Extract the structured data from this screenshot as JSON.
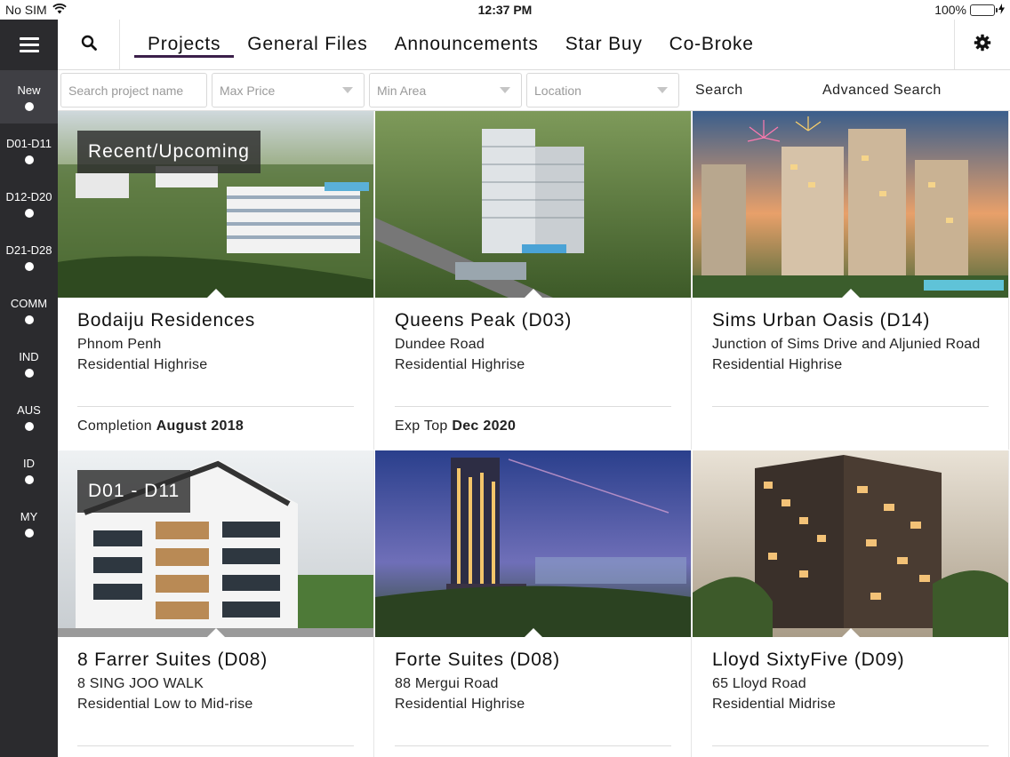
{
  "status_bar": {
    "carrier": "No SIM",
    "time": "12:37 PM",
    "battery": "100%",
    "battery_level": 1.0
  },
  "sidebar": {
    "items": [
      {
        "label": "New",
        "active": true
      },
      {
        "label": "D01-D11",
        "active": false
      },
      {
        "label": "D12-D20",
        "active": false
      },
      {
        "label": "D21-D28",
        "active": false
      },
      {
        "label": "COMM",
        "active": false
      },
      {
        "label": "IND",
        "active": false
      },
      {
        "label": "AUS",
        "active": false
      },
      {
        "label": "ID",
        "active": false
      },
      {
        "label": "MY",
        "active": false
      }
    ]
  },
  "nav": {
    "tabs": [
      {
        "label": "Projects",
        "active": true
      },
      {
        "label": "General Files",
        "active": false
      },
      {
        "label": "Announcements",
        "active": false
      },
      {
        "label": "Star Buy",
        "active": false
      },
      {
        "label": "Co-Broke",
        "active": false
      }
    ]
  },
  "filters": {
    "search_placeholder": "Search project name",
    "search_value": "",
    "max_price": "Max Price",
    "min_area": "Min Area",
    "location": "Location",
    "search_button": "Search",
    "advanced_button": "Advanced Search"
  },
  "cards": [
    {
      "badge": "Recent/Upcoming",
      "title": "Bodaiju Residences",
      "line1": "Phnom Penh",
      "line2": "Residential Highrise",
      "foot_label": "Completion",
      "foot_value": "August 2018"
    },
    {
      "badge": "",
      "title": "Queens Peak (D03)",
      "line1": "Dundee Road",
      "line2": "Residential Highrise",
      "foot_label": "Exp Top",
      "foot_value": "Dec 2020"
    },
    {
      "badge": "",
      "title": "Sims Urban Oasis (D14)",
      "line1": "Junction of Sims Drive and Aljunied Road",
      "line2": "Residential Highrise",
      "foot_label": "",
      "foot_value": ""
    },
    {
      "badge": "D01 - D11",
      "title": "8 Farrer Suites (D08)",
      "line1": "8 SING JOO WALK",
      "line2": "Residential Low to Mid-rise",
      "foot_label": "",
      "foot_value": ""
    },
    {
      "badge": "",
      "title": "Forte Suites (D08)",
      "line1": "88 Mergui Road",
      "line2": "Residential Highrise",
      "foot_label": "",
      "foot_value": ""
    },
    {
      "badge": "",
      "title": "Lloyd SixtyFive (D09)",
      "line1": "65 Lloyd Road",
      "line2": "Residential Midrise",
      "foot_label": "",
      "foot_value": ""
    }
  ],
  "colors": {
    "sidebar_bg": "#2b2b2e",
    "tab_underline": "#3b1f4a",
    "battery": "#4cd964"
  }
}
